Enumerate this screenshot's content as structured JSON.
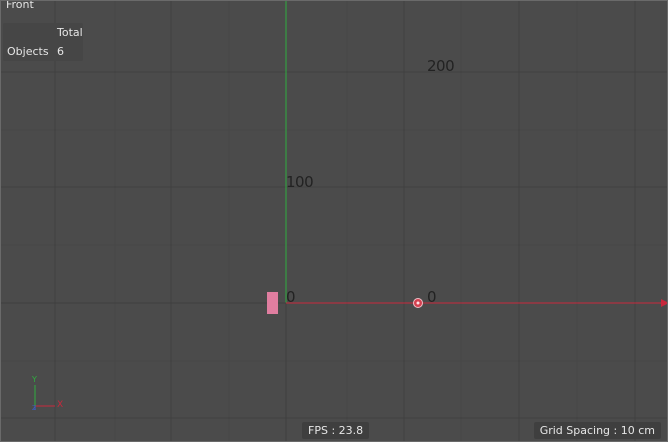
{
  "viewport": {
    "view_name": "Front",
    "colors": {
      "background": "#4b4b4b",
      "y_axis": "#2fae3f",
      "x_axis": "#c8283c",
      "object": "#e07ea0"
    }
  },
  "stats": {
    "header": "Total",
    "objects_label": "Objects",
    "objects_value": "6"
  },
  "axis_labels": {
    "y_200": "200",
    "y_100": "100",
    "origin_0": "0",
    "x_0": "0"
  },
  "status_bar": {
    "fps": "FPS : 23.8",
    "grid_spacing": "Grid Spacing : 10 cm"
  },
  "orientation_gizmo": {
    "y_label": "Y",
    "x_label": "X",
    "z_label": "Z"
  }
}
